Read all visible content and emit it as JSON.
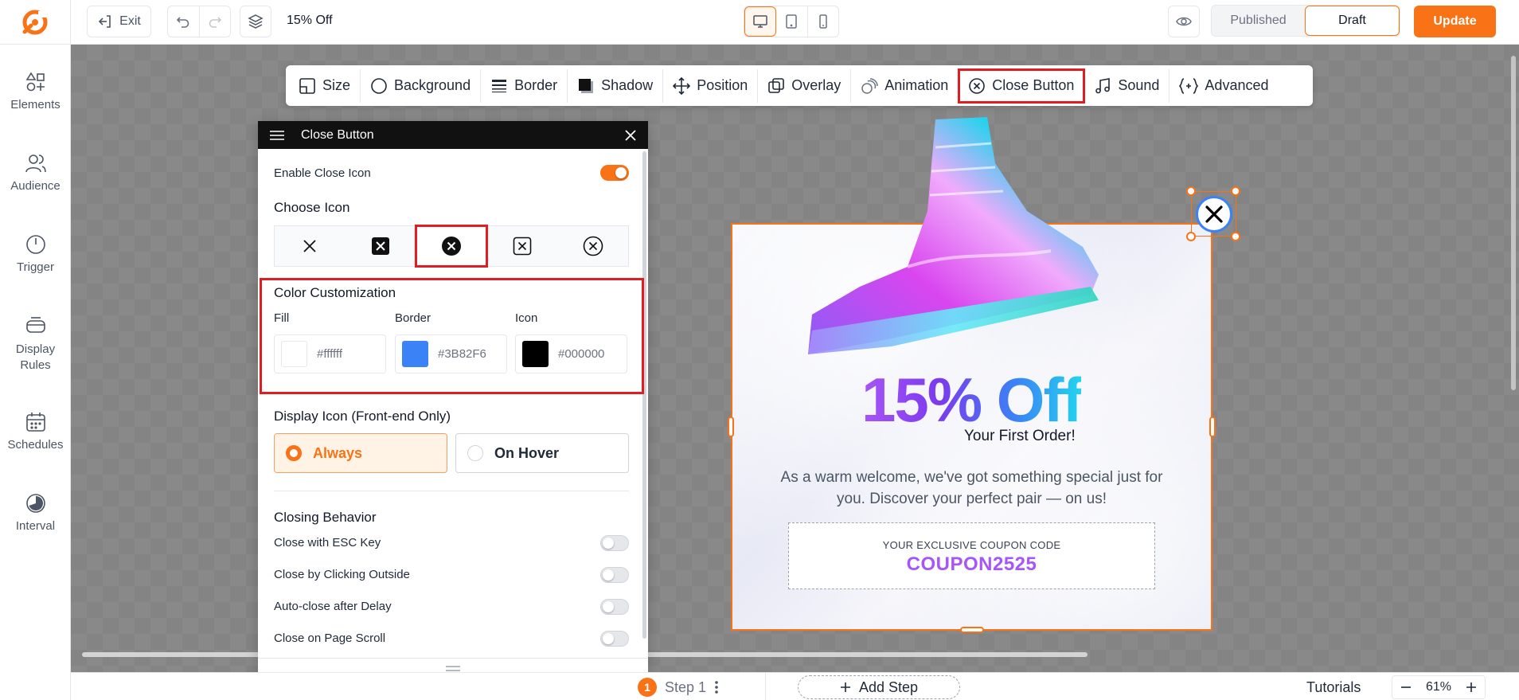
{
  "topbar": {
    "exit_label": "Exit",
    "page_name": "15% Off",
    "published_label": "Published",
    "draft_label": "Draft",
    "update_label": "Update",
    "accent_color": "#f97316"
  },
  "sidebar": {
    "items": [
      {
        "label": "Elements",
        "icon": "elements-icon"
      },
      {
        "label": "Audience",
        "icon": "audience-icon"
      },
      {
        "label": "Trigger",
        "icon": "power-icon"
      },
      {
        "label": "Display Rules",
        "icon": "display-rules-icon"
      },
      {
        "label": "Schedules",
        "icon": "calendar-icon"
      },
      {
        "label": "Interval",
        "icon": "interval-icon"
      }
    ]
  },
  "toolbar": {
    "items": [
      {
        "label": "Size",
        "icon": "size-icon"
      },
      {
        "label": "Background",
        "icon": "background-icon"
      },
      {
        "label": "Border",
        "icon": "border-icon"
      },
      {
        "label": "Shadow",
        "icon": "shadow-icon"
      },
      {
        "label": "Position",
        "icon": "position-icon"
      },
      {
        "label": "Overlay",
        "icon": "overlay-icon"
      },
      {
        "label": "Animation",
        "icon": "animation-icon"
      },
      {
        "label": "Close Button",
        "icon": "close-circle-icon",
        "highlighted": true
      },
      {
        "label": "Sound",
        "icon": "music-icon"
      },
      {
        "label": "Advanced",
        "icon": "code-braces-icon"
      }
    ]
  },
  "panel": {
    "title": "Close Button",
    "enable_close_icon_label": "Enable Close Icon",
    "enable_close_icon_on": true,
    "choose_icon_title": "Choose Icon",
    "icon_options": [
      "x-icon",
      "x-square-filled-icon",
      "x-circle-filled-icon",
      "x-square-outline-icon",
      "x-circle-outline-icon"
    ],
    "selected_icon_index": 2,
    "color_title": "Color Customization",
    "colors": {
      "fill_label": "Fill",
      "fill_value": "#ffffff",
      "border_label": "Border",
      "border_value": "#3B82F6",
      "icon_label": "Icon",
      "icon_value": "#000000"
    },
    "display_title": "Display Icon (Front-end Only)",
    "display_options": [
      "Always",
      "On Hover"
    ],
    "display_selected": "Always",
    "closing_title": "Closing Behavior",
    "closing_options": [
      {
        "label": "Close with ESC Key",
        "on": false
      },
      {
        "label": "Close by Clicking Outside",
        "on": false
      },
      {
        "label": "Auto-close after Delay",
        "on": false
      },
      {
        "label": "Close on Page Scroll",
        "on": false
      }
    ]
  },
  "popup": {
    "headline": "15% Off",
    "subheadline": "Your First Order!",
    "body": "As a warm welcome, we've got something special just for you. Discover your perfect pair — on us!",
    "coupon_label": "YOUR EXCLUSIVE COUPON CODE",
    "coupon_code": "COUPON2525"
  },
  "bottombar": {
    "step_number": "1",
    "step_label": "Step 1",
    "add_step_label": "Add Step",
    "tutorials_label": "Tutorials",
    "zoom_value": "61%"
  }
}
